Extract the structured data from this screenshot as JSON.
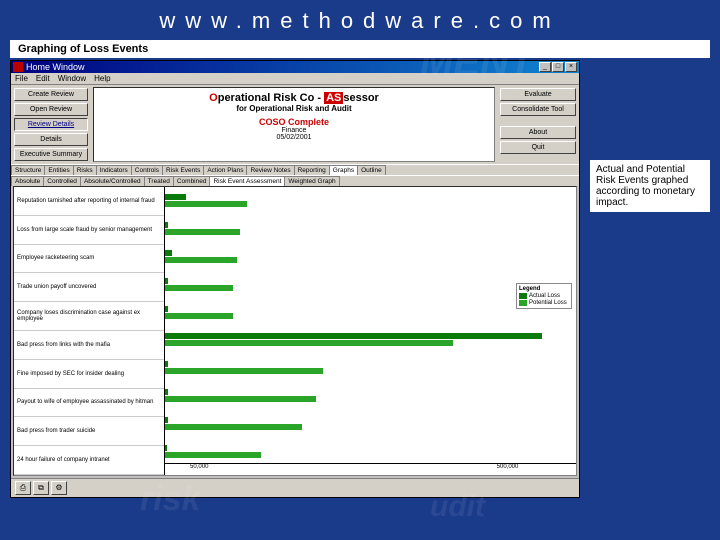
{
  "header_url": "www.methodware.com",
  "slide_title": "Graphing of Loss Events",
  "window": {
    "title": "Home Window",
    "menus": [
      "File",
      "Edit",
      "Window",
      "Help"
    ]
  },
  "left_buttons": [
    "Create Review",
    "Open Review",
    "Review Details",
    "Details",
    "Executive Summary"
  ],
  "left_selected_index": 2,
  "right_buttons": [
    "Evaluate",
    "Consolidate Tool",
    "About",
    "Quit"
  ],
  "banner": {
    "line1_o": "O",
    "line1_mid": "perational Risk Co - ",
    "line1_as": "AS",
    "line1_tail": "sessor",
    "line2": "for Operational Risk and Audit",
    "red_title": "COSO Complete",
    "sub1": "Finance",
    "sub2": "05/02/2001"
  },
  "tabs_row1": [
    "Structure",
    "Entities",
    "Risks",
    "Indicators",
    "Controls",
    "Risk Events",
    "Action Plans",
    "Review Notes",
    "Reporting",
    "Graphs",
    "Outline"
  ],
  "tabs_row1_active": 9,
  "tabs_row2": [
    "Absolute",
    "Controlled",
    "Absolute/Controlled",
    "Treated",
    "Combined",
    "Risk Event Assessment",
    "Weighted Graph"
  ],
  "tabs_row2_active": 5,
  "legend": {
    "title": "Legend",
    "items": [
      {
        "name": "Actual Loss",
        "color": "#0a7a0a"
      },
      {
        "name": "Potential Loss",
        "color": "#2aa52a"
      }
    ]
  },
  "annotation": "Actual and Potential Risk Events graphed according to monetary impact.",
  "x_ticks": [
    "50,000",
    "500,000"
  ],
  "chart_data": {
    "type": "bar",
    "title": "Risk Event Assessment",
    "xlabel": "",
    "ylabel": "",
    "xlim": [
      0,
      600000
    ],
    "categories": [
      "Reputation tarnished after reporting of internal fraud",
      "Loss from large scale fraud by senior management",
      "Employee racketeering scam",
      "Trade union payoff uncovered",
      "Company loses discrimination case against ex employee",
      "Bad press from links with the mafia",
      "Fine imposed by SEC for insider dealing",
      "Payout to wife of employee assassinated by hitman",
      "Bad press from trader suicide",
      "24 hour failure of company intranet"
    ],
    "series": [
      {
        "name": "Actual Loss",
        "values": [
          30000,
          5000,
          10000,
          5000,
          5000,
          550000,
          5000,
          5000,
          5000,
          3000
        ]
      },
      {
        "name": "Potential Loss",
        "values": [
          120000,
          110000,
          105000,
          100000,
          100000,
          420000,
          230000,
          220000,
          200000,
          140000
        ]
      }
    ]
  }
}
